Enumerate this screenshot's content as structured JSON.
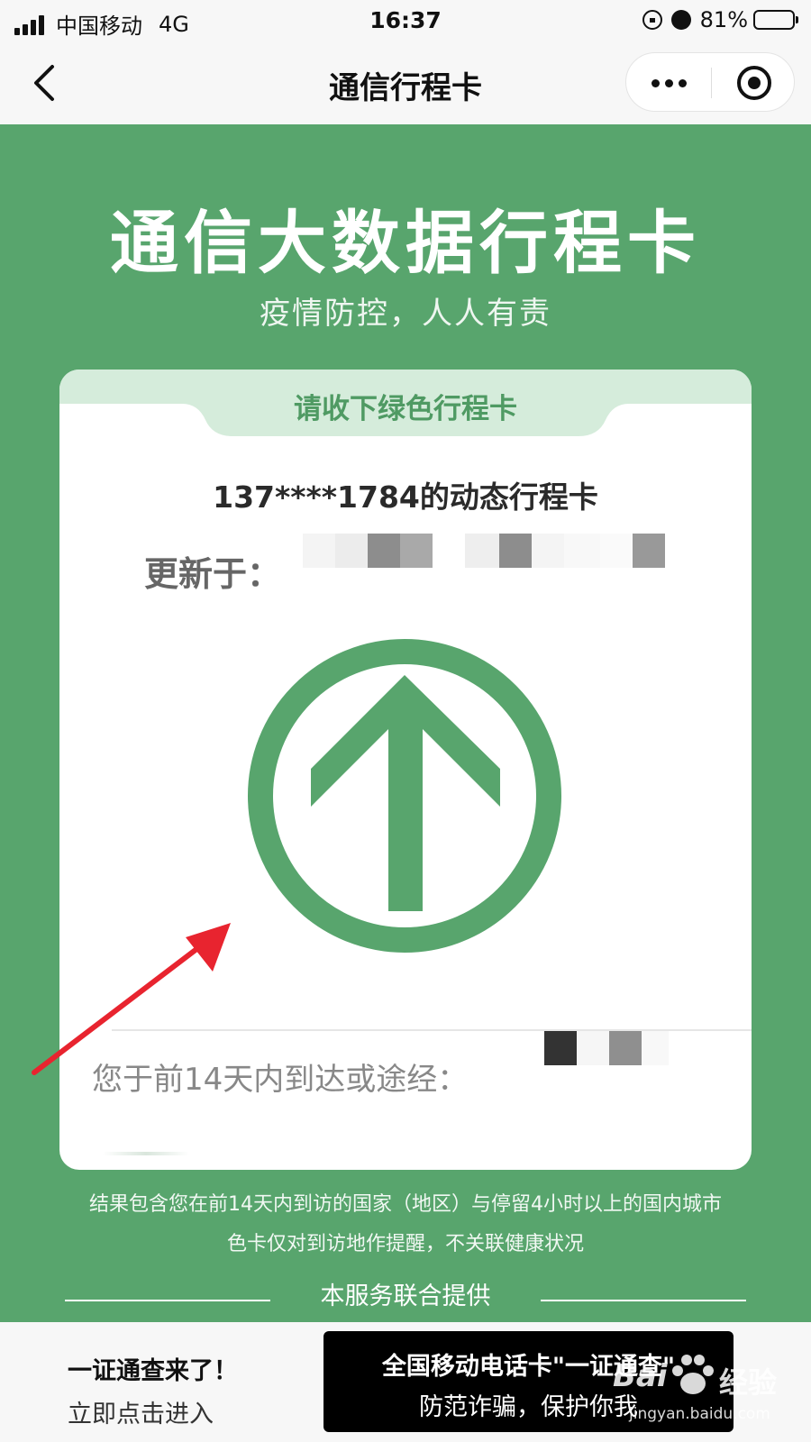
{
  "status_bar": {
    "carrier": "中国移动",
    "network": "4G",
    "time": "16:37",
    "battery": "81%",
    "battery_level": 0.81
  },
  "nav": {
    "title": "通信行程卡",
    "back_icon": "chevron-left-icon",
    "more_icon": "more-dots-icon",
    "close_icon": "target-close-icon"
  },
  "header": {
    "title": "通信大数据行程卡",
    "slogan": "疫情防控，人人有责"
  },
  "card": {
    "tab_label": "请收下绿色行程卡",
    "phone_line": "137****1784的动态行程卡",
    "update_label": "更新于：",
    "visited_label": "您于前14天内到达或途经：",
    "status_color": "#58a56d",
    "status_icon": "up-arrow-circle-icon"
  },
  "notes": {
    "line1": "结果包含您在前14天内到访的国家（地区）与停留4小时以上的国内城市",
    "line2": "色卡仅对到访地作提醒，不关联健康状况",
    "provided": "本服务联合提供"
  },
  "bottom": {
    "promo_title": "一证通查来了！",
    "promo_link": "立即点击进入",
    "banner_line1": "全国移动电话卡\"一证通查\"",
    "banner_line2": "防范诈骗，保护你我"
  },
  "watermark": {
    "brand": "Bai",
    "brand_cn": "经验",
    "url": "jingyan.baidu.com"
  },
  "colors": {
    "green": "#58a56d",
    "light_green": "#d5ecdb",
    "annotation_red": "#e8242f"
  }
}
